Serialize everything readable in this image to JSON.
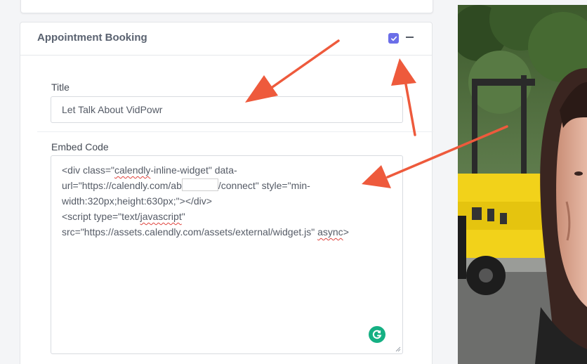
{
  "card": {
    "title": "Appointment Booking",
    "enabled": true
  },
  "form": {
    "title_label": "Title",
    "title_value": "Let Talk About VidPowr",
    "embed_label": "Embed Code",
    "embed_lines": [
      [
        "<div class=\"",
        "calendly",
        "-inline-widget\" data-"
      ],
      [
        "url=\"https://calendly.com/ab",
        "",
        "/connect\" style=\"min-"
      ],
      [
        "width:320px;height:630px;\"></div>"
      ],
      [
        "<script type=\"text/",
        "javascript",
        "\""
      ],
      [
        "src=\"https://assets.calendly.com/assets/external/widget.js\" ",
        "async",
        ">"
      ]
    ]
  },
  "icons": {
    "checkbox": "check-icon",
    "collapse": "minus-icon",
    "grammarly": "grammarly-icon"
  },
  "colors": {
    "accent": "#6b6ee8",
    "arrow": "#ee5a3c",
    "grammarly": "#15b083",
    "forklift": "#f2d21a"
  }
}
